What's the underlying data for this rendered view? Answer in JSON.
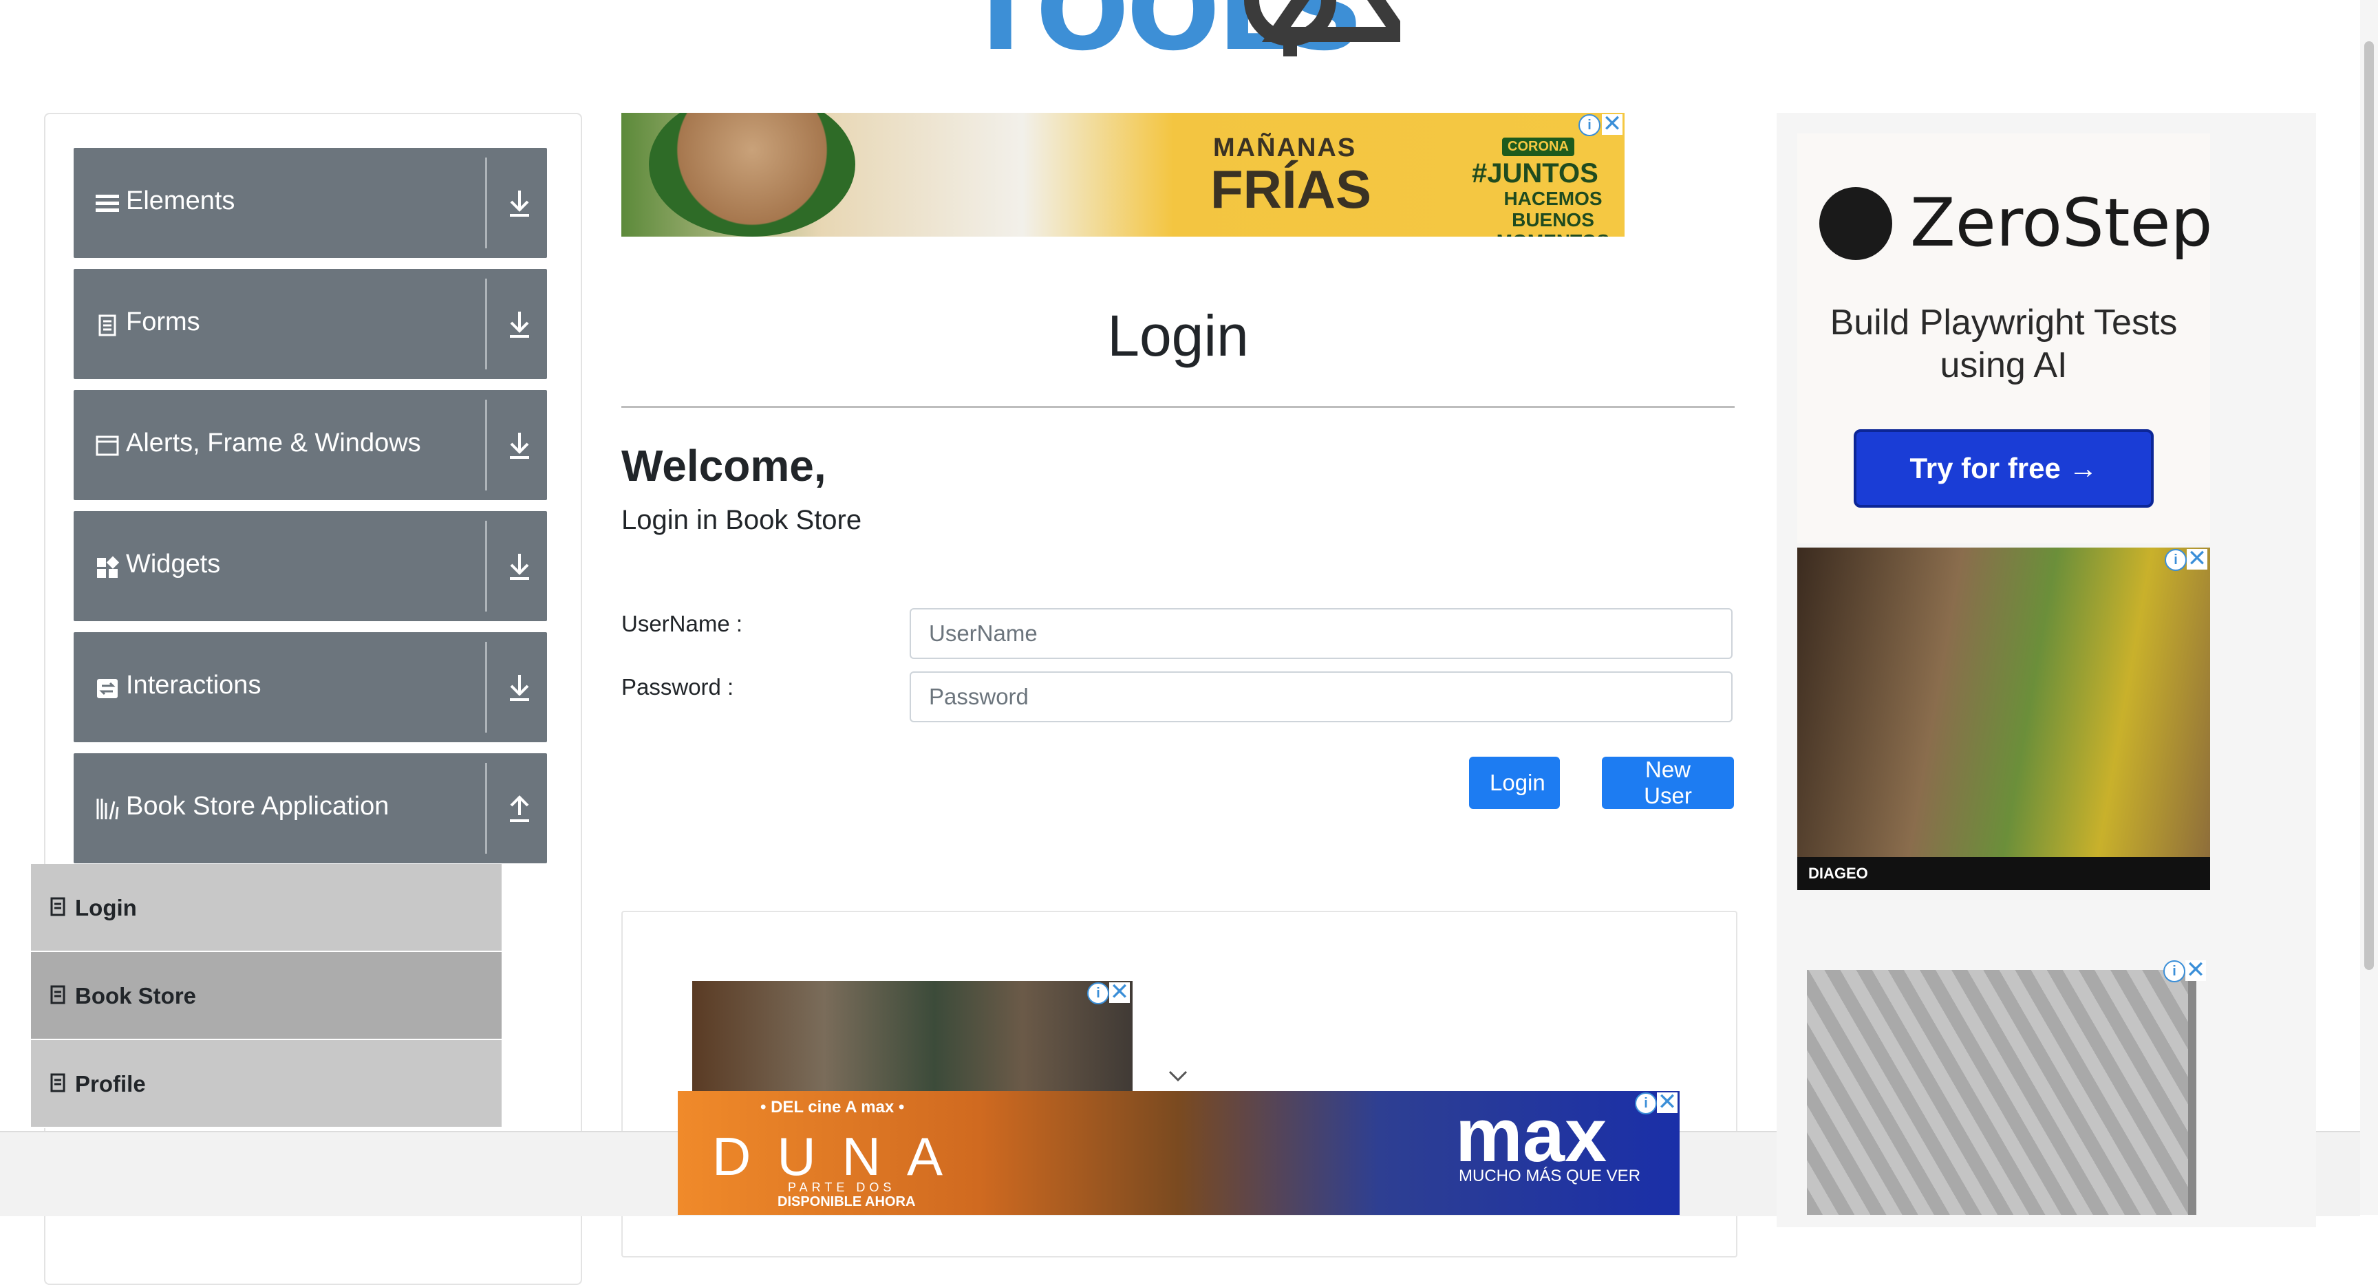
{
  "header": {
    "logo_text": "TOOLS",
    "logo_suffix": "QA"
  },
  "sidebar": {
    "groups": [
      {
        "label": "Elements",
        "icon": "hamburger-icon",
        "arrow": "download-arrow-icon"
      },
      {
        "label": "Forms",
        "icon": "form-icon",
        "arrow": "download-arrow-icon"
      },
      {
        "label": "Alerts, Frame & Windows",
        "icon": "window-icon",
        "arrow": "download-arrow-icon"
      },
      {
        "label": "Widgets",
        "icon": "widgets-icon",
        "arrow": "download-arrow-icon"
      },
      {
        "label": "Interactions",
        "icon": "interactions-icon",
        "arrow": "download-arrow-icon"
      },
      {
        "label": "Book Store Application",
        "icon": "books-icon",
        "arrow": "upload-arrow-icon"
      }
    ],
    "sub_items": [
      {
        "label": "Login"
      },
      {
        "label": "Book Store"
      },
      {
        "label": "Profile"
      }
    ]
  },
  "ads": {
    "top": {
      "line1": "MAÑANAS",
      "line2": "FRÍAS",
      "badge": "CORONA",
      "tag": "#JUNTOS",
      "tag2": "HACEMOS BUENOS\nMOMENTOS"
    },
    "right": {
      "brand": "ZeroStep",
      "copy": "Build Playwright Tests using AI",
      "cta": "Try for free →",
      "sponsor": "DIAGEO"
    },
    "bottom": {
      "pre": "• DEL cine A max •",
      "title": "DUNA",
      "sub": "PARTE DOS",
      "avail": "DISPONIBLE AHORA",
      "brand": "max",
      "tagline": "MUCHO MÁS QUE VER"
    },
    "info_glyph": "i",
    "close_glyph": "✕"
  },
  "main": {
    "page_title": "Login",
    "welcome": "Welcome,",
    "subtitle": "Login in Book Store",
    "username_label": "UserName :",
    "username_placeholder": "UserName",
    "username_value": "",
    "password_label": "Password :",
    "password_placeholder": "Password",
    "password_value": "",
    "login_button": "Login",
    "new_user_button": "New User"
  },
  "colors": {
    "accent": "#1d7cf2",
    "sidebar_group": "#6c757d",
    "sub_item": "#c8c8c8",
    "sub_item_active": "#acacac"
  }
}
